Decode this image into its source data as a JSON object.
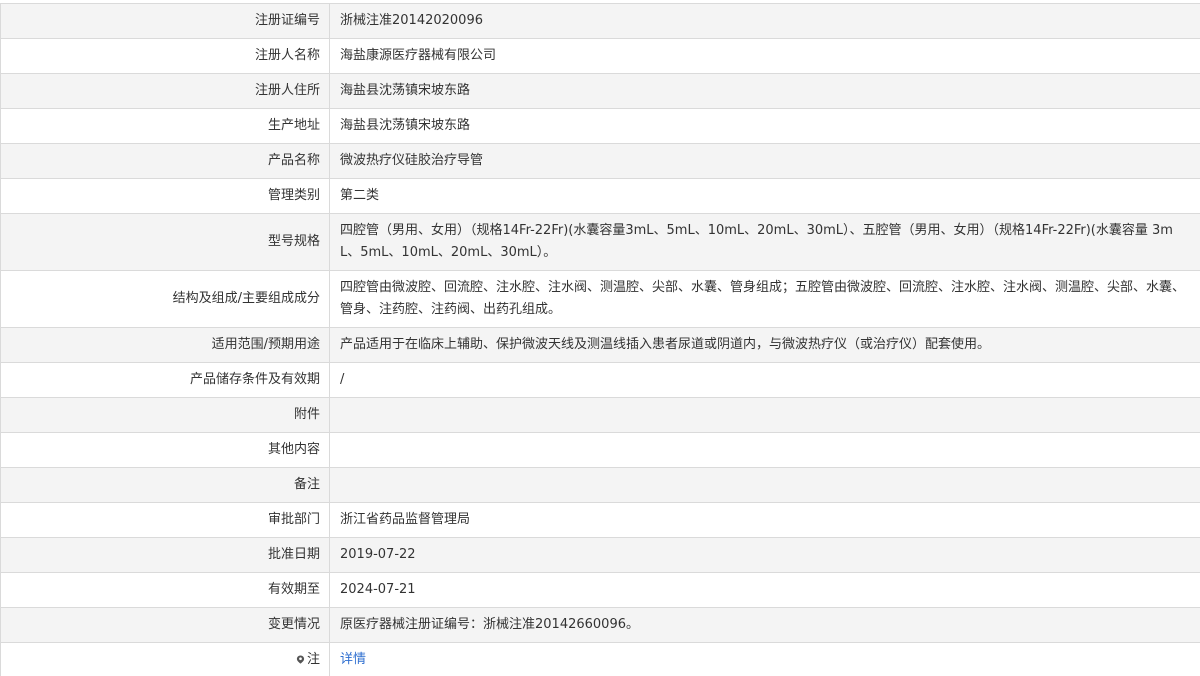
{
  "rows": [
    {
      "label": "注册证编号",
      "value": "浙械注准20142020096"
    },
    {
      "label": "注册人名称",
      "value": "海盐康源医疗器械有限公司"
    },
    {
      "label": "注册人住所",
      "value": "海盐县沈荡镇宋坡东路"
    },
    {
      "label": "生产地址",
      "value": "海盐县沈荡镇宋坡东路"
    },
    {
      "label": "产品名称",
      "value": "微波热疗仪硅胶治疗导管"
    },
    {
      "label": "管理类别",
      "value": "第二类"
    },
    {
      "label": "型号规格",
      "value": "四腔管（男用、女用）（规格14Fr-22Fr)(水囊容量3mL、5mL、10mL、20mL、30mL）、五腔管（男用、女用）（规格14Fr-22Fr)(水囊容量 3mL、5mL、10mL、20mL、30mL）。"
    },
    {
      "label": "结构及组成/主要组成成分",
      "value": "四腔管由微波腔、回流腔、注水腔、注水阀、测温腔、尖部、水囊、管身组成；五腔管由微波腔、回流腔、注水腔、注水阀、测温腔、尖部、水囊、管身、注药腔、注药阀、出药孔组成。"
    },
    {
      "label": "适用范围/预期用途",
      "value": "产品适用于在临床上辅助、保护微波天线及测温线插入患者尿道或阴道内，与微波热疗仪（或治疗仪）配套使用。"
    },
    {
      "label": "产品储存条件及有效期",
      "value": "/"
    },
    {
      "label": "附件",
      "value": ""
    },
    {
      "label": "其他内容",
      "value": ""
    },
    {
      "label": "备注",
      "value": ""
    },
    {
      "label": "审批部门",
      "value": "浙江省药品监督管理局"
    },
    {
      "label": "批准日期",
      "value": "2019-07-22"
    },
    {
      "label": "有效期至",
      "value": "2024-07-21"
    },
    {
      "label": "变更情况",
      "value": "原医疗器械注册证编号：浙械注准20142660096。"
    }
  ],
  "note": {
    "label": "注",
    "link": "详情",
    "icon": "map-pin-icon",
    "link_color": "#2f6fd0"
  }
}
